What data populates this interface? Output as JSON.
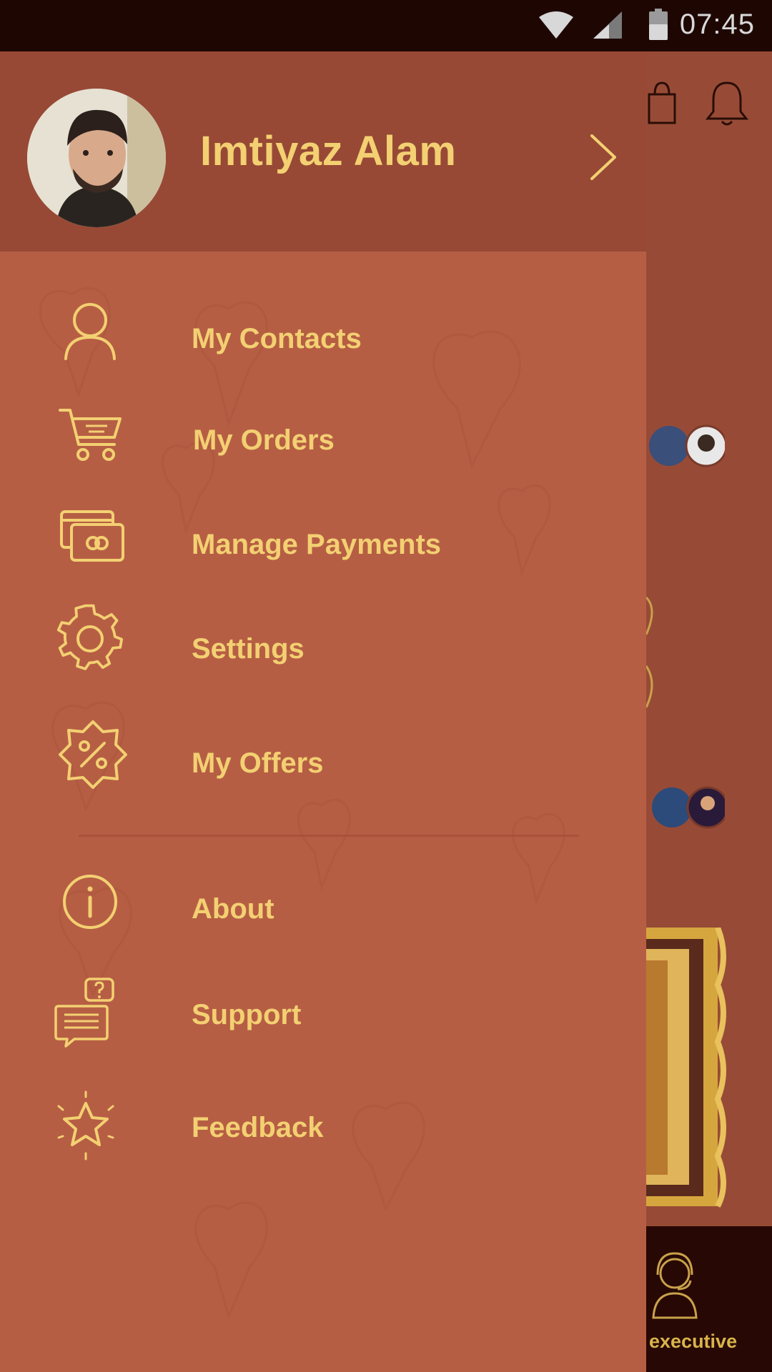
{
  "status_bar": {
    "time": "07:45"
  },
  "drawer": {
    "user_name": "Imtiyaz Alam",
    "menu": [
      {
        "label": "My Contacts",
        "icon": "person-icon"
      },
      {
        "label": "My Orders",
        "icon": "cart-icon"
      },
      {
        "label": "Manage Payments",
        "icon": "cards-icon"
      },
      {
        "label": "Settings",
        "icon": "gear-icon"
      },
      {
        "label": "My Offers",
        "icon": "percent-badge-icon"
      },
      {
        "label": "About",
        "icon": "info-icon"
      },
      {
        "label": "Support",
        "icon": "chat-question-icon"
      },
      {
        "label": "Feedback",
        "icon": "star-icon"
      }
    ]
  },
  "background_app": {
    "executive_label": "executive"
  },
  "colors": {
    "drawer_bg": "#b65e44",
    "header_bg": "#974935",
    "accent_text": "#f3d072",
    "status_bar_bg": "#1e0703"
  }
}
